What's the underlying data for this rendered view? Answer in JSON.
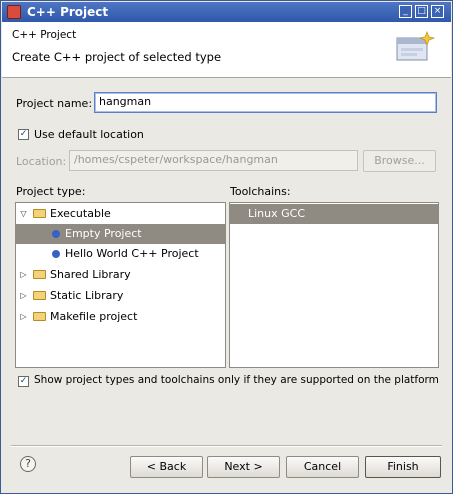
{
  "window": {
    "title": "C++ Project"
  },
  "header": {
    "title": "C++ Project",
    "description": "Create C++ project of selected type"
  },
  "project_name": {
    "label": "Project name:",
    "value": "hangman"
  },
  "default_location": {
    "label": "Use default location",
    "checked": true
  },
  "location": {
    "label": "Location:",
    "value": "/homes/cspeter/workspace/hangman",
    "browse_label": "Browse..."
  },
  "project_type": {
    "label": "Project type:",
    "items": [
      {
        "label": "Executable",
        "kind": "folder",
        "expanded": true
      },
      {
        "label": "Empty Project",
        "kind": "leaf",
        "selected": true
      },
      {
        "label": "Hello World C++ Project",
        "kind": "leaf"
      },
      {
        "label": "Shared Library",
        "kind": "folder",
        "expanded": false
      },
      {
        "label": "Static Library",
        "kind": "folder",
        "expanded": false
      },
      {
        "label": "Makefile project",
        "kind": "folder",
        "expanded": false
      }
    ]
  },
  "toolchains": {
    "label": "Toolchains:",
    "items": [
      {
        "label": "Linux GCC",
        "selected": true
      }
    ]
  },
  "filter_option": {
    "label": "Show project types and toolchains only if they are supported on the platform",
    "checked": true
  },
  "buttons": {
    "back": "< Back",
    "next": "Next >",
    "cancel": "Cancel",
    "finish": "Finish"
  },
  "icons": {
    "app": "c-cpp-project-icon",
    "help": "help-icon",
    "wizard": "wizard-banner-icon"
  }
}
